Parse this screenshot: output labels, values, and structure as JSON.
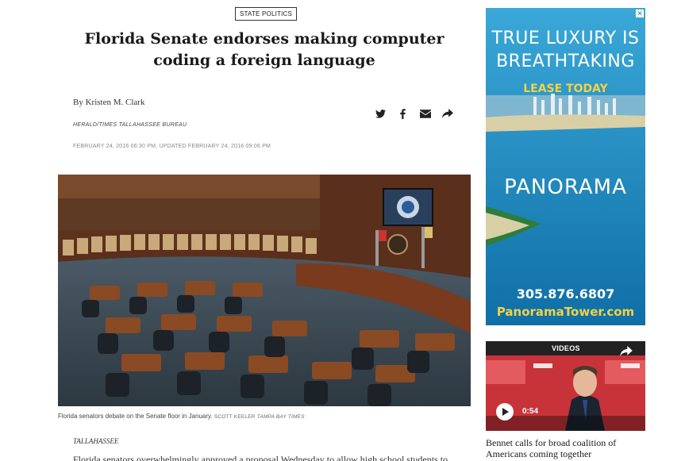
{
  "article": {
    "section": "STATE POLITICS",
    "headline": "Florida Senate endorses making computer coding a foreign language",
    "byline": "By Kristen M. Clark",
    "bureau": "HERALD/TIMES TALLAHASSEE BUREAU",
    "dateline": "FEBRUARY 24, 2016 06:30 PM, UPDATED FEBRUARY 24, 2016 09:06 PM",
    "photo_caption": "Florida senators debate on the Senate floor in January.",
    "photo_credit_name": "SCOTT KEELER",
    "photo_credit_org": "TAMPA BAY TIMES",
    "city": "TALLAHASSEE",
    "body_start": "Florida senators overwhelmingly approved a proposal Wednesday to allow high school students to"
  },
  "share": {
    "icons": [
      "twitter-icon",
      "facebook-icon",
      "email-icon",
      "share-icon"
    ]
  },
  "ad": {
    "line1": "TRUE LUXURY IS",
    "line2": "BREATHTAKING",
    "cta": "LEASE TODAY",
    "brand": "PANORAMA",
    "phone": "305.876.6807",
    "url": "PanoramaTower.com",
    "close": "✕"
  },
  "video": {
    "label": "VIDEOS",
    "duration": "0:54",
    "title": "Bennet calls for broad coalition of Americans coming together"
  },
  "colors": {
    "ad_blue": "#1e8fc1",
    "ad_yellow": "#f3d245",
    "video_red": "#c8333a"
  }
}
